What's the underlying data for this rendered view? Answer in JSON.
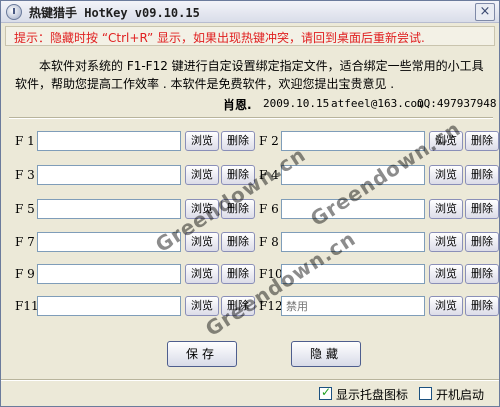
{
  "window": {
    "title": "热键猎手 HotKey v09.10.15",
    "close_glyph": "×"
  },
  "tip": "提示：隐藏时按 “Ctrl+R” 显示，如果出现热键冲突，请回到桌面后重新尝试.",
  "description": "本软件对系统的 F1-F12 键进行自定设置绑定指定文件，适合绑定一些常用的小工具软件，帮助您提高工作效率 . 本软件是免费软件，欢迎您提出宝贵意见 .",
  "author": {
    "name": "肖恩.",
    "date": "2009.10.15",
    "email": "atfeel@163.com",
    "qq": "QQ:497937948"
  },
  "buttons": {
    "browse": "浏览",
    "delete": "删除",
    "save": "保存",
    "hide": "隐藏"
  },
  "hotkeys": [
    {
      "key": "F 1",
      "value": "",
      "placeholder": ""
    },
    {
      "key": "F 2",
      "value": "",
      "placeholder": ""
    },
    {
      "key": "F 3",
      "value": "",
      "placeholder": ""
    },
    {
      "key": "F 4",
      "value": "",
      "placeholder": ""
    },
    {
      "key": "F 5",
      "value": "",
      "placeholder": ""
    },
    {
      "key": "F 6",
      "value": "",
      "placeholder": ""
    },
    {
      "key": "F 7",
      "value": "",
      "placeholder": ""
    },
    {
      "key": "F 8",
      "value": "",
      "placeholder": ""
    },
    {
      "key": "F 9",
      "value": "",
      "placeholder": ""
    },
    {
      "key": "F10",
      "value": "",
      "placeholder": ""
    },
    {
      "key": "F11",
      "value": "",
      "placeholder": ""
    },
    {
      "key": "F12",
      "value": "",
      "placeholder": "禁用"
    }
  ],
  "options": {
    "show_tray_icon": {
      "label": "显示托盘图标",
      "checked": true
    },
    "auto_start": {
      "label": "开机启动",
      "checked": false
    }
  },
  "watermark": "Greendown.cn",
  "colors": {
    "tip_text": "#e02020",
    "window_bg": "#ece9d8",
    "checkmark": "#21a121"
  }
}
